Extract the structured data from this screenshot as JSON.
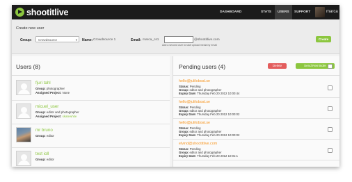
{
  "app": {
    "logo_text": "shootitlive"
  },
  "nav": [
    {
      "label": "DASHBOARD",
      "active": false
    },
    {
      "label": "STATS",
      "active": false
    },
    {
      "label": "USERS",
      "active": true
    },
    {
      "label": "SUPPORT",
      "active": false
    }
  ],
  "user": {
    "name": "marca"
  },
  "create": {
    "title": "Create new user",
    "group_label": "Group:",
    "group_value": "Crowdsource",
    "name_label": "Name:",
    "name_value": "Crowdsource 1",
    "email_label": "Email:",
    "email_prefix": "marca_cs1",
    "email_domain": "@shootitlive.com",
    "email_hint": "Add a second user to start upload media by email",
    "create_button": "Create"
  },
  "users": {
    "title": "Users (8)",
    "items": [
      {
        "name": "fjuri tahl",
        "group_label": "Group:",
        "group": "photographer",
        "project_label": "Assigned Project:",
        "project": "None"
      },
      {
        "name": "micuel_user",
        "group_label": "Group:",
        "group": "editor and photographer",
        "project_label": "Assigned Project:",
        "project": "skatewhite"
      },
      {
        "name": "mr bruno",
        "group_label": "Group:",
        "group": "editor"
      },
      {
        "name": "test ioll",
        "group_label": "Group:",
        "group": "editor"
      }
    ]
  },
  "pending": {
    "title": "Pending users (4)",
    "delete_button": "Delete",
    "reminder_button": "Send Reminder",
    "items": [
      {
        "email": "hello@juliloboal.se",
        "status_label": "Status:",
        "status": "Pending",
        "group_label": "Group:",
        "group": "editor and photographer",
        "expiry_label": "Expiry Date:",
        "expiry": "Thursday Feb 20 2012 10:00:44"
      },
      {
        "email": "hello@juliloboal.se",
        "status_label": "Status:",
        "status": "Pending",
        "group_label": "Group:",
        "group": "editor and photographer",
        "expiry_label": "Expiry Date:",
        "expiry": "Thursday Feb 20 2012 10:00:02"
      },
      {
        "email": "hello@juliloboal.se",
        "status_label": "Status:",
        "status": "Pending",
        "group_label": "Group:",
        "group": "editor and photographer",
        "expiry_label": "Expiry Date:",
        "expiry": "Thursday Feb 20 2012 10:00:02"
      },
      {
        "email": "elvind@shootitlive.com",
        "status_label": "Status:",
        "status": "Pending",
        "group_label": "Group:",
        "group": "editor and photographer",
        "expiry_label": "Expiry Date:",
        "expiry": "Thursday Feb 20 2012 10:01:1"
      }
    ]
  },
  "colors": {
    "accent": "#8cc63f",
    "danger": "#e35d5d",
    "pending_email": "#f7941d",
    "topbar": "#1b1b1b"
  }
}
